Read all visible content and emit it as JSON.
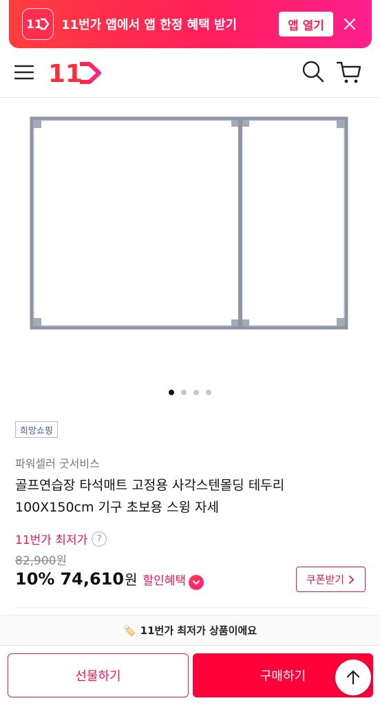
{
  "banner": {
    "logo_text": "11",
    "text": "11번가 앱에서 앱 한정 혜택 받기",
    "open_label": "앱 열기"
  },
  "header": {
    "logo_text": "11"
  },
  "carousel": {
    "total": 4,
    "active": 1
  },
  "product": {
    "tag": "희망쇼핑",
    "seller": "파워셀러 굿서비스",
    "title": "골프연습장 타석매트 고정용 사각스텐몰딩 테두리 100X150cm 기구 초보용 스윙 자세",
    "lowest_label": "11번가 최저가",
    "help_glyph": "?",
    "original_price": "82,900",
    "original_unit": "원",
    "discount_rate": "10%",
    "sale_price": "74,610",
    "sale_unit": "원",
    "benefit_label": "할인혜택",
    "coupon_label": "쿠폰받기"
  },
  "strip": {
    "emoji": "🏷️",
    "text": "11번가 최저가 상품이에요"
  },
  "bottom": {
    "gift_label": "선물하기",
    "buy_label": "구매하기"
  },
  "colors": {
    "accent": "#e8174d",
    "buy": "#ff0038",
    "tag_blue": "#3c5d93"
  }
}
